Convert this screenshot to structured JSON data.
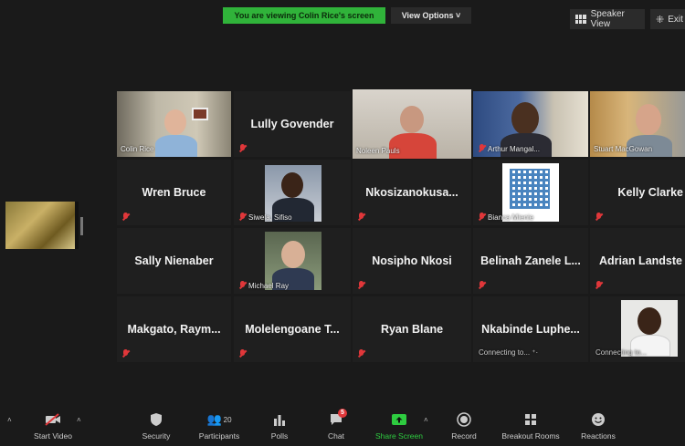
{
  "banner": {
    "viewing": "You are viewing Colin Rice's screen",
    "view_options": "View Options ˅"
  },
  "top_right": {
    "speaker_view": "Speaker View",
    "exit": "Exit"
  },
  "tiles": {
    "t1": "Colin Rice",
    "t2": "Lully Govender",
    "t3": "Noleen Pauls",
    "t4": "Arthur Mangal...",
    "t5": "Stuart MacGowan",
    "t6": "Wren Bruce",
    "t7": "Siwela, Sifiso",
    "t8": "Nkosizanokusa...",
    "t9": "Bianca Mienie",
    "t10": "Kelly Clarke",
    "t11": "Sally Nienaber",
    "t12": "Michael Ray",
    "t13": "Nosipho Nkosi",
    "t14": "Belinah Zanele L...",
    "t15": "Adrian Landste",
    "t16": "Makgato, Raym...",
    "t17": "Molelengoane T...",
    "t18": "Ryan Blane",
    "t19": "Nkabinde Luphe...",
    "t19_status": "Connecting to... ⁺·",
    "t20_status": "Connecting to..."
  },
  "toolbar": {
    "start_video": "Start Video",
    "security": "Security",
    "participants": "Participants",
    "participants_count": "20",
    "polls": "Polls",
    "chat": "Chat",
    "chat_badge": "5",
    "share_screen": "Share Screen",
    "record": "Record",
    "breakout_rooms": "Breakout Rooms",
    "reactions": "Reactions"
  },
  "colors": {
    "banner_green": "#30b33a",
    "active_speaker": "#cfe86e",
    "mute_red": "#e0373a",
    "share_green": "#2ecc40"
  }
}
